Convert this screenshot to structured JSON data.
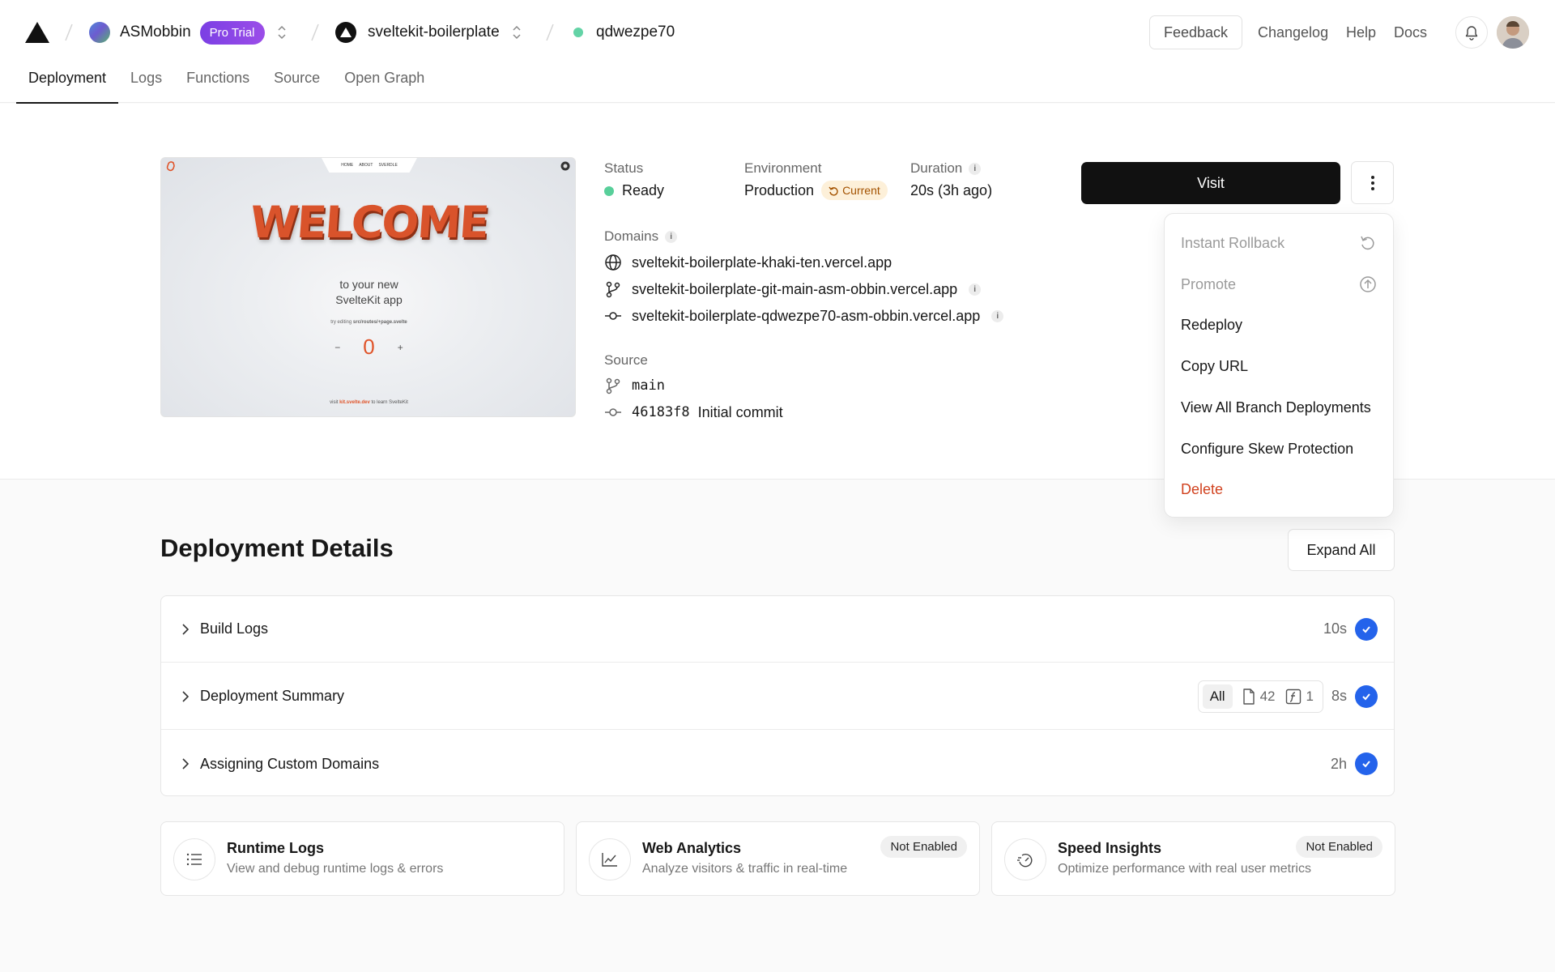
{
  "header": {
    "team_name": "ASMobbin",
    "plan_badge": "Pro Trial",
    "project_name": "sveltekit-boilerplate",
    "deployment_id": "qdwezpe70",
    "feedback_label": "Feedback",
    "links": [
      "Changelog",
      "Help",
      "Docs"
    ]
  },
  "tabs": [
    "Deployment",
    "Logs",
    "Functions",
    "Source",
    "Open Graph"
  ],
  "preview": {
    "nav": [
      "HOME",
      "ABOUT",
      "SVERDLE"
    ],
    "headline": "WELCOME",
    "subtitle_line1": "to your new",
    "subtitle_line2": "SvelteKit app",
    "hint_prefix": "try editing",
    "hint_path": "src/routes/+page.svelte",
    "counter_minus": "−",
    "counter_value": "0",
    "counter_plus": "+",
    "footer_prefix": "visit",
    "footer_link": "kit.svelte.dev",
    "footer_suffix": "to learn SvelteKit"
  },
  "info": {
    "status_label": "Status",
    "status_value": "Ready",
    "environment_label": "Environment",
    "environment_value": "Production",
    "current_badge": "Current",
    "duration_label": "Duration",
    "duration_value": "20s (3h ago)",
    "domains_label": "Domains",
    "domains": [
      "sveltekit-boilerplate-khaki-ten.vercel.app",
      "sveltekit-boilerplate-git-main-asm-obbin.vercel.app",
      "sveltekit-boilerplate-qdwezpe70-asm-obbin.vercel.app"
    ],
    "source_label": "Source",
    "branch": "main",
    "commit_hash": "46183f8",
    "commit_message": "Initial commit"
  },
  "actions": {
    "visit_label": "Visit"
  },
  "menu": {
    "items": [
      "Instant Rollback",
      "Promote",
      "Redeploy",
      "Copy URL",
      "View All Branch Deployments",
      "Configure Skew Protection",
      "Delete"
    ]
  },
  "details": {
    "title": "Deployment Details",
    "expand_label": "Expand All",
    "rows": [
      {
        "title": "Build Logs",
        "time": "10s"
      },
      {
        "title": "Deployment Summary",
        "time": "8s",
        "filter_all": "All",
        "files_count": "42",
        "functions_count": "1"
      },
      {
        "title": "Assigning Custom Domains",
        "time": "2h"
      }
    ]
  },
  "cards": [
    {
      "title": "Runtime Logs",
      "desc": "View and debug runtime logs & errors",
      "badge": ""
    },
    {
      "title": "Web Analytics",
      "desc": "Analyze visitors & traffic in real-time",
      "badge": "Not Enabled"
    },
    {
      "title": "Speed Insights",
      "desc": "Optimize performance with real user metrics",
      "badge": "Not Enabled"
    }
  ],
  "colors": {
    "accent_blue": "#2463eb",
    "ready_green": "#58cf9a",
    "danger_red": "#d1421f",
    "pro_purple": "#7b3fe4"
  }
}
